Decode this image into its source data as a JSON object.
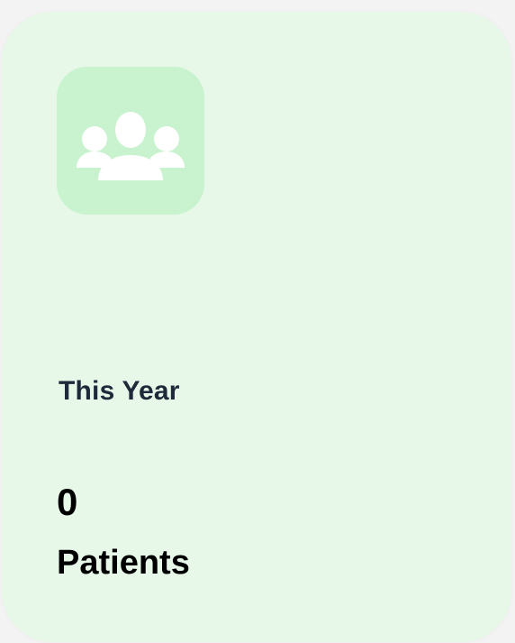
{
  "card": {
    "icon": "users-icon",
    "period_label": "This Year",
    "value": "0",
    "unit_label": "Patients"
  },
  "colors": {
    "card_background": "#e7f8e9",
    "icon_tile_background": "#c9f3ce",
    "icon_color": "#ffffff"
  }
}
